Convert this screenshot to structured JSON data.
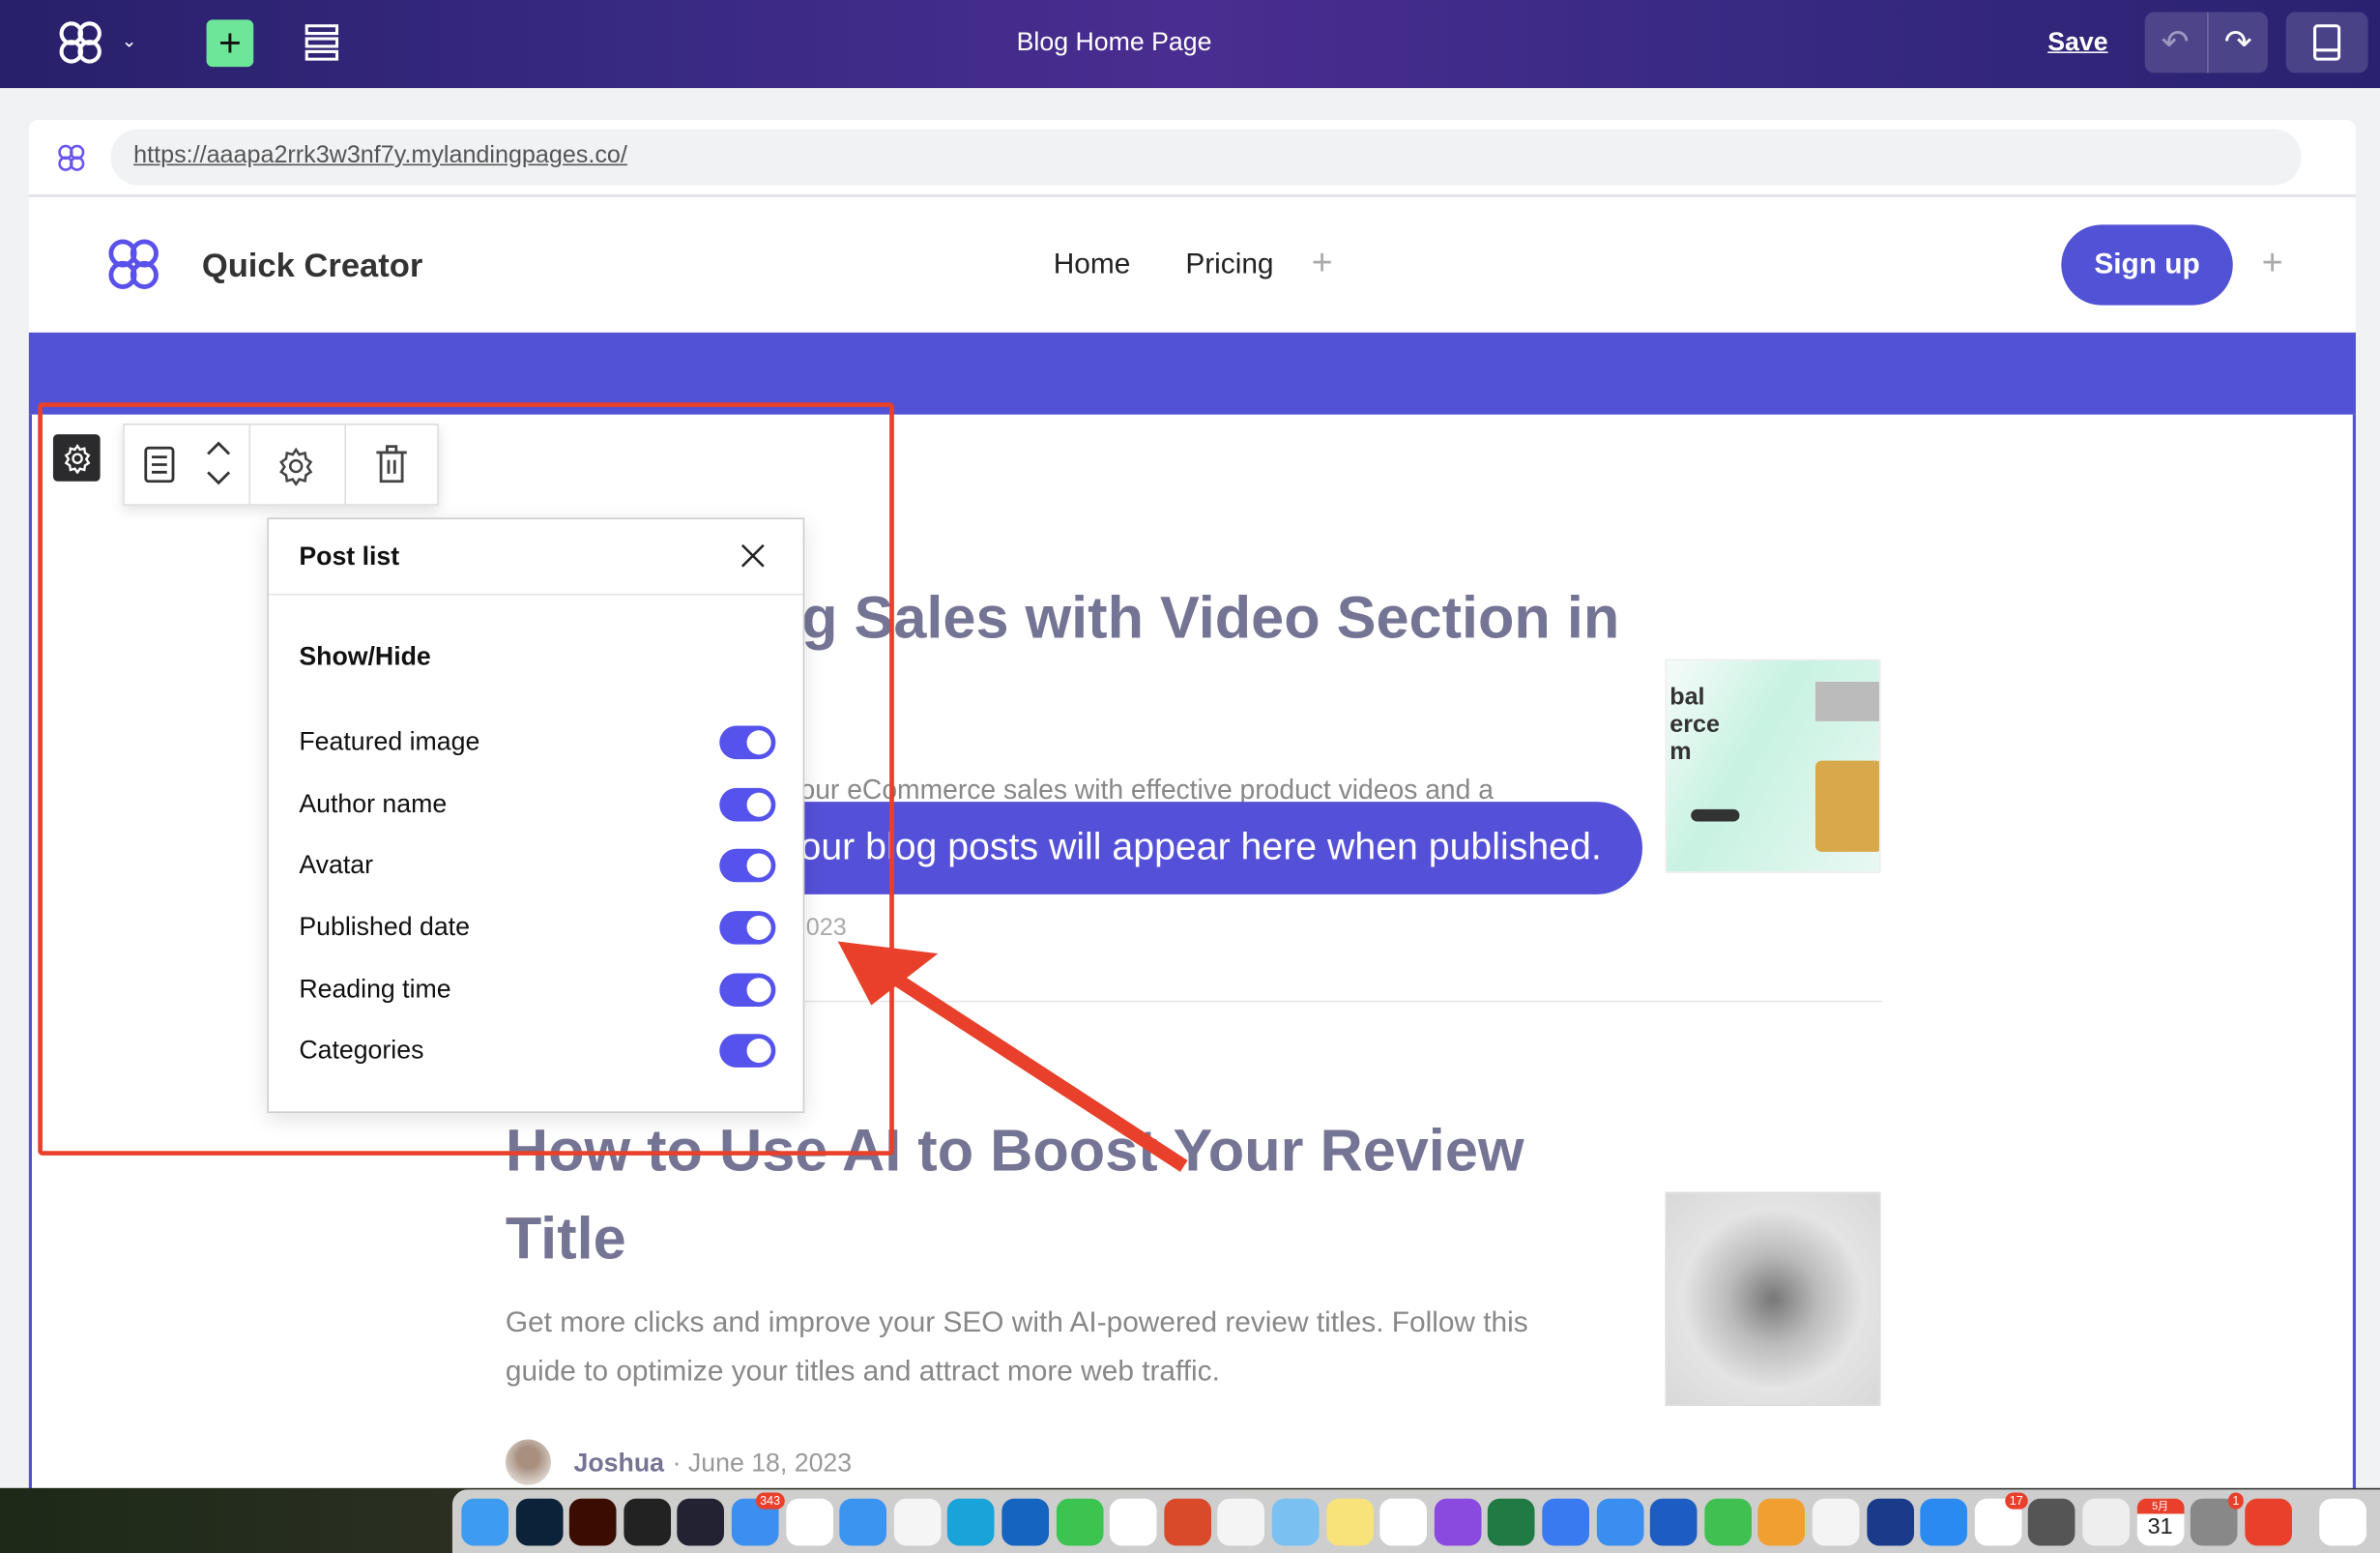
{
  "editor": {
    "page_title": "Blog Home Page",
    "save_label": "Save",
    "icons": [
      "logo-icon",
      "chevron-down-icon",
      "add-icon",
      "layers-icon",
      "undo-icon",
      "redo-icon",
      "device-preview-icon"
    ],
    "accent": "#6ee69a"
  },
  "browser": {
    "url": "https://aaapa2rrk3w3nf7y.mylandingpages.co/"
  },
  "site": {
    "brand": "Quick Creator",
    "nav": [
      "Home",
      "Pricing"
    ],
    "signup": "Sign up",
    "brand_color": "#5252d6"
  },
  "block_toolbar": {
    "icons": [
      "settings-icon",
      "list-icon",
      "chevron-up-icon",
      "chevron-down-icon",
      "gear-icon",
      "trash-icon"
    ]
  },
  "panel": {
    "title": "Post list",
    "section": "Show/Hide",
    "options": [
      {
        "label": "Featured image",
        "on": true
      },
      {
        "label": "Author name",
        "on": true
      },
      {
        "label": "Avatar",
        "on": true
      },
      {
        "label": "Published date",
        "on": true
      },
      {
        "label": "Reading time",
        "on": true
      },
      {
        "label": "Categories",
        "on": true
      }
    ],
    "toggle_color": "#5553ec"
  },
  "posts": [
    {
      "title_visible": "g Sales with Video Section in",
      "desc_visible": "our eCommerce sales with effective product videos and a",
      "date_visible": "023"
    },
    {
      "title_line1": "How to Use AI to Boost Your Review",
      "title_line2": "Title",
      "desc_line1": "Get more clicks and improve your SEO with AI-powered review titles. Follow this",
      "desc_line2": "guide to optimize your titles and attract more web traffic.",
      "author": "Joshua",
      "date": "· June 18, 2023"
    }
  ],
  "empty_notice": "our blog posts will appear here when published.",
  "annotation_color": "#e8402a",
  "dock": {
    "badges": {
      "mail": "343",
      "photos": "17",
      "settings": "1"
    },
    "calendar": {
      "month": "5月",
      "day": "31"
    }
  }
}
